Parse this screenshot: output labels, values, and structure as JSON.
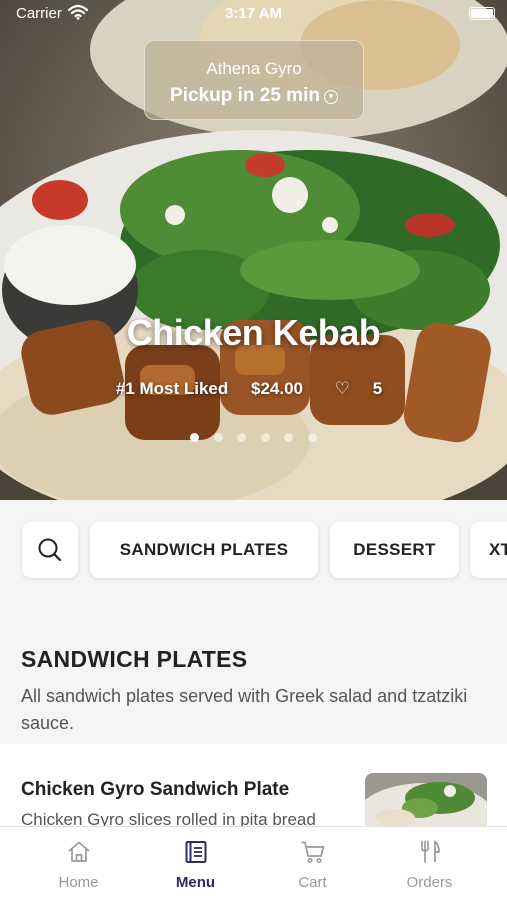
{
  "status_bar": {
    "carrier": "Carrier",
    "time": "3:17 AM"
  },
  "store": {
    "name": "Athena Gyro",
    "pickup": "Pickup in 25 min",
    "chevron_icon": "chevron-down-circle-icon"
  },
  "featured": {
    "title": "Chicken Kebab",
    "rank": "#1 Most Liked",
    "price": "$24.00",
    "likes": "5",
    "like_icon": "heart-icon",
    "slide_count": 6,
    "active_slide": 1
  },
  "categories": {
    "search_icon": "search-icon",
    "items": [
      "SANDWICH PLATES",
      "DESSERT",
      "XT"
    ]
  },
  "section": {
    "title": "SANDWICH PLATES",
    "description": "All sandwich plates served with Greek salad and tzatziki sauce."
  },
  "menu_items": [
    {
      "name": "Chicken Gyro Sandwich Plate",
      "description": "Chicken Gyro slices rolled in pita bread"
    }
  ],
  "tabs": [
    {
      "label": "Home",
      "icon": "home-icon"
    },
    {
      "label": "Menu",
      "icon": "menu-book-icon",
      "active": true
    },
    {
      "label": "Cart",
      "icon": "cart-icon"
    },
    {
      "label": "Orders",
      "icon": "fork-knife-icon"
    }
  ],
  "colors": {
    "accent": "#2d2b63",
    "inactive": "#9a9a9a",
    "background": "#f5f5f5"
  }
}
